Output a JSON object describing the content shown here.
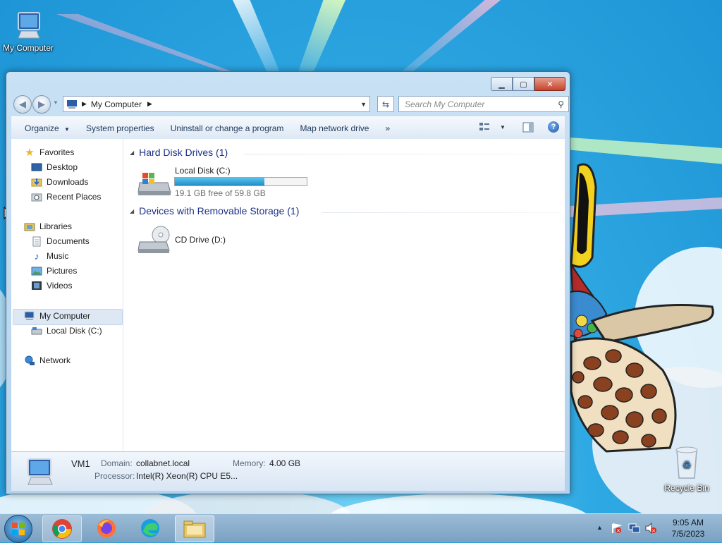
{
  "desktop": {
    "icons": [
      {
        "label": "My Computer",
        "icon": "computer-icon"
      },
      {
        "label": "Recycle Bin",
        "icon": "recycle-bin-icon"
      }
    ]
  },
  "window": {
    "title": "My Computer",
    "address": {
      "crumb": "My Computer"
    },
    "search": {
      "placeholder": "Search My Computer"
    },
    "toolbar": {
      "organize": "Organize",
      "system_properties": "System properties",
      "uninstall": "Uninstall or change a program",
      "map_drive": "Map network drive",
      "more": "»"
    },
    "nav": {
      "favorites": "Favorites",
      "desktop": "Desktop",
      "downloads": "Downloads",
      "recent_places": "Recent Places",
      "libraries": "Libraries",
      "documents": "Documents",
      "music": "Music",
      "pictures": "Pictures",
      "videos": "Videos",
      "my_computer": "My Computer",
      "local_disk": "Local Disk (C:)",
      "network": "Network"
    },
    "groups": {
      "hard_disks": {
        "title": "Hard Disk Drives (1)",
        "items": [
          {
            "name": "Local Disk (C:)",
            "free_text": "19.1 GB free of 59.8 GB",
            "used_fraction": 0.68
          }
        ]
      },
      "removable": {
        "title": "Devices with Removable Storage (1)",
        "items": [
          {
            "name": "CD Drive (D:)"
          }
        ]
      }
    },
    "details": {
      "name": "VM1",
      "domain_label": "Domain:",
      "domain_value": "collabnet.local",
      "memory_label": "Memory:",
      "memory_value": "4.00 GB",
      "processor_label": "Processor:",
      "processor_value": "Intel(R) Xeon(R) CPU E5..."
    }
  },
  "taskbar": {
    "apps": [
      "chrome-icon",
      "firefox-icon",
      "edge-icon",
      "explorer-icon"
    ],
    "clock": {
      "time": "9:05 AM",
      "date": "7/5/2023"
    }
  },
  "colors": {
    "link_blue": "#1e3287",
    "disk_bar": "#26a0da",
    "selection": "#dde8f4"
  }
}
